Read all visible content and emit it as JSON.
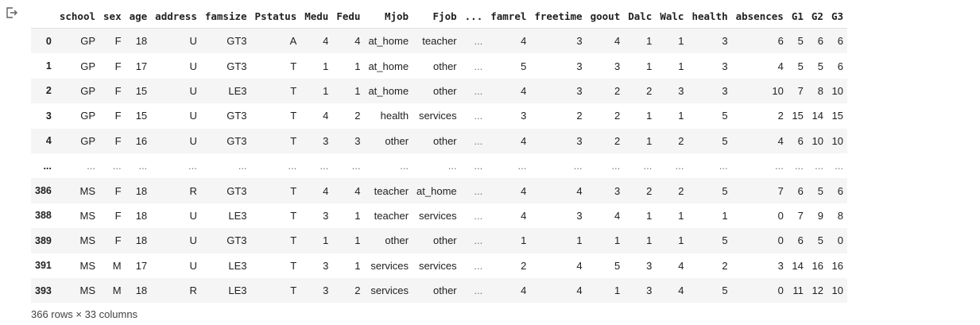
{
  "output_icon": "output-redirect-icon",
  "columns": [
    "",
    "school",
    "sex",
    "age",
    "address",
    "famsize",
    "Pstatus",
    "Medu",
    "Fedu",
    "Mjob",
    "Fjob",
    "...",
    "famrel",
    "freetime",
    "goout",
    "Dalc",
    "Walc",
    "health",
    "absences",
    "G1",
    "G2",
    "G3"
  ],
  "rows": [
    [
      "0",
      "GP",
      "F",
      "18",
      "U",
      "GT3",
      "A",
      "4",
      "4",
      "at_home",
      "teacher",
      "...",
      "4",
      "3",
      "4",
      "1",
      "1",
      "3",
      "6",
      "5",
      "6",
      "6"
    ],
    [
      "1",
      "GP",
      "F",
      "17",
      "U",
      "GT3",
      "T",
      "1",
      "1",
      "at_home",
      "other",
      "...",
      "5",
      "3",
      "3",
      "1",
      "1",
      "3",
      "4",
      "5",
      "5",
      "6"
    ],
    [
      "2",
      "GP",
      "F",
      "15",
      "U",
      "LE3",
      "T",
      "1",
      "1",
      "at_home",
      "other",
      "...",
      "4",
      "3",
      "2",
      "2",
      "3",
      "3",
      "10",
      "7",
      "8",
      "10"
    ],
    [
      "3",
      "GP",
      "F",
      "15",
      "U",
      "GT3",
      "T",
      "4",
      "2",
      "health",
      "services",
      "...",
      "3",
      "2",
      "2",
      "1",
      "1",
      "5",
      "2",
      "15",
      "14",
      "15"
    ],
    [
      "4",
      "GP",
      "F",
      "16",
      "U",
      "GT3",
      "T",
      "3",
      "3",
      "other",
      "other",
      "...",
      "4",
      "3",
      "2",
      "1",
      "2",
      "5",
      "4",
      "6",
      "10",
      "10"
    ],
    [
      "...",
      "...",
      "...",
      "...",
      "...",
      "...",
      "...",
      "...",
      "...",
      "...",
      "...",
      "...",
      "...",
      "...",
      "...",
      "...",
      "...",
      "...",
      "...",
      "...",
      "...",
      "..."
    ],
    [
      "386",
      "MS",
      "F",
      "18",
      "R",
      "GT3",
      "T",
      "4",
      "4",
      "teacher",
      "at_home",
      "...",
      "4",
      "4",
      "3",
      "2",
      "2",
      "5",
      "7",
      "6",
      "5",
      "6"
    ],
    [
      "388",
      "MS",
      "F",
      "18",
      "U",
      "LE3",
      "T",
      "3",
      "1",
      "teacher",
      "services",
      "...",
      "4",
      "3",
      "4",
      "1",
      "1",
      "1",
      "0",
      "7",
      "9",
      "8"
    ],
    [
      "389",
      "MS",
      "F",
      "18",
      "U",
      "GT3",
      "T",
      "1",
      "1",
      "other",
      "other",
      "...",
      "1",
      "1",
      "1",
      "1",
      "1",
      "5",
      "0",
      "6",
      "5",
      "0"
    ],
    [
      "391",
      "MS",
      "M",
      "17",
      "U",
      "LE3",
      "T",
      "3",
      "1",
      "services",
      "services",
      "...",
      "2",
      "4",
      "5",
      "3",
      "4",
      "2",
      "3",
      "14",
      "16",
      "16"
    ],
    [
      "393",
      "MS",
      "M",
      "18",
      "R",
      "LE3",
      "T",
      "3",
      "2",
      "services",
      "other",
      "...",
      "4",
      "4",
      "1",
      "3",
      "4",
      "5",
      "0",
      "11",
      "12",
      "10"
    ]
  ],
  "shape_text": "366 rows × 33 columns"
}
